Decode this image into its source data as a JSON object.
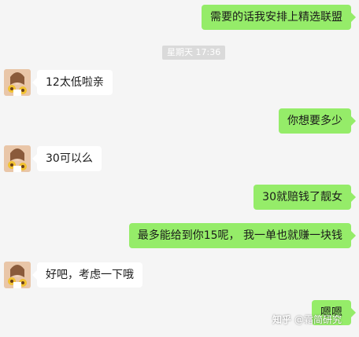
{
  "messages": [
    {
      "side": "out",
      "text": "需要的话我安排上精选联盟"
    },
    {
      "side": "time",
      "text": "星期天 17:36"
    },
    {
      "side": "in",
      "text": "12太低啦亲"
    },
    {
      "side": "out",
      "text": "你想要多少"
    },
    {
      "side": "in",
      "text": "30可以么"
    },
    {
      "side": "out",
      "text": "30就赔钱了靓女"
    },
    {
      "side": "out",
      "text": "最多能给到你15呢， 我一单也就赚一块钱"
    },
    {
      "side": "in",
      "text": "好吧，考虑一下哦"
    },
    {
      "side": "out",
      "text": "嗯嗯"
    }
  ],
  "watermark": {
    "brand": "知乎",
    "author": "@霜简研究"
  },
  "colors": {
    "outgoing_bubble": "#95ec69",
    "incoming_bubble": "#ffffff",
    "background": "#f5f5f5",
    "timestamp_bg": "#dadada"
  },
  "icons": {
    "avatar": "avatar-sunflower-girl"
  }
}
